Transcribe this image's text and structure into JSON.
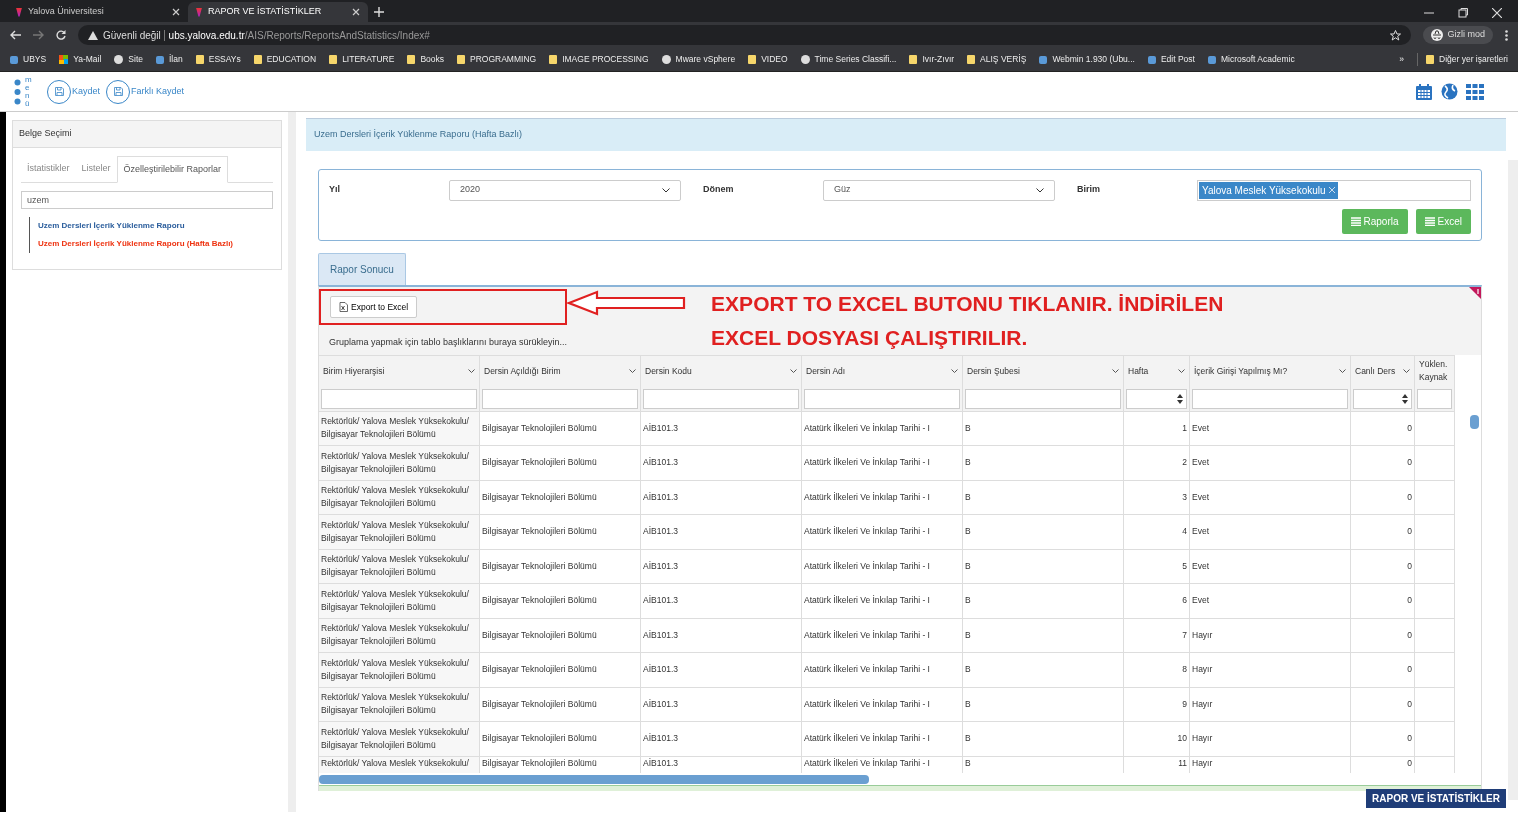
{
  "browser": {
    "tabs": [
      {
        "title": "Yalova Üniversitesi",
        "selected": false
      },
      {
        "title": "RAPOR VE İSTATİSTİKLER",
        "selected": true
      }
    ],
    "address": {
      "security": "Güvenli değil",
      "host": "ubs.yalova.edu.tr",
      "path": "/AIS/Reports/ReportsAndStatistics/Index#"
    },
    "profile": "Gizli mod",
    "bookmarks": [
      {
        "label": "UBYS",
        "kind": "app"
      },
      {
        "label": "Ya-Mail",
        "kind": "windows"
      },
      {
        "label": "Site",
        "kind": "globe"
      },
      {
        "label": "İlan",
        "kind": "app"
      },
      {
        "label": "ESSAYs",
        "kind": "folder"
      },
      {
        "label": "EDUCATION",
        "kind": "folder"
      },
      {
        "label": "LITERATURE",
        "kind": "folder"
      },
      {
        "label": "Books",
        "kind": "folder"
      },
      {
        "label": "PROGRAMMING",
        "kind": "folder"
      },
      {
        "label": "IMAGE PROCESSING",
        "kind": "folder"
      },
      {
        "label": "Mware vSphere",
        "kind": "globe"
      },
      {
        "label": "VIDEO",
        "kind": "folder"
      },
      {
        "label": "Time Series Classifi...",
        "kind": "globe"
      },
      {
        "label": "Ivır-Zıvır",
        "kind": "folder"
      },
      {
        "label": "ALIŞ VERİŞ",
        "kind": "folder"
      },
      {
        "label": "Webmin 1.930 (Ubu...",
        "kind": "app"
      },
      {
        "label": "Edit Post",
        "kind": "app"
      },
      {
        "label": "Microsoft Academic",
        "kind": "app"
      }
    ],
    "overflow": "»",
    "other_bookmarks": "Diğer yer işaretleri"
  },
  "toolbar": {
    "menu_label": "menü",
    "buttons": [
      "Kaydet",
      "Farklı Kaydet"
    ]
  },
  "sidebar": {
    "title": "Belge Seçimi",
    "tabs": [
      {
        "label": "İstatistikler",
        "selected": false
      },
      {
        "label": "Listeler",
        "selected": false
      },
      {
        "label": "Özelleştirilebilir Raporlar",
        "selected": true
      }
    ],
    "search": "uzem",
    "items": [
      {
        "label": "Uzem Dersleri İçerik Yüklenme Raporu",
        "selected": false
      },
      {
        "label": "Uzem Dersleri İçerik Yüklenme Raporu (Hafta Bazlı)",
        "selected": true
      }
    ]
  },
  "report": {
    "title": "Uzem Dersleri İçerik Yüklenme Raporu (Hafta Bazlı)",
    "filters": [
      {
        "label": "Yıl",
        "kind": "select",
        "value": "2020"
      },
      {
        "label": "Dönem",
        "kind": "select",
        "value": "Güz"
      },
      {
        "label": "Birim",
        "kind": "tags",
        "value": "Yalova Meslek Yüksekokulu"
      }
    ],
    "buttons": [
      "Raporla",
      "Excel"
    ],
    "result_tab": "Rapor Sonucu",
    "export_button": "Export to Excel",
    "group_hint": "Gruplama yapmak için tablo başlıklarını buraya sürükleyin...",
    "annotation": [
      "EXPORT TO EXCEL BUTONU TIKLANIR. İNDİRİLEN",
      "EXCEL DOSYASI ÇALIŞTIRILIR."
    ],
    "columns": [
      {
        "label": "Birim Hiyerarşisi",
        "kind": "text"
      },
      {
        "label": "Dersin Açıldığı Birim",
        "kind": "text"
      },
      {
        "label": "Dersin Kodu",
        "kind": "text"
      },
      {
        "label": "Dersin Adı",
        "kind": "text"
      },
      {
        "label": "Dersin Şubesi",
        "kind": "text"
      },
      {
        "label": "Hafta",
        "kind": "number"
      },
      {
        "label": "İçerik Girişi Yapılmış Mı?",
        "kind": "text"
      },
      {
        "label": "Canlı Ders",
        "kind": "number"
      },
      {
        "label": "Yüklen. Kaynak",
        "kind": "cut"
      }
    ],
    "rows": [
      [
        "Rektörlük/ Yalova Meslek Yüksekokulu/ Bilgisayar Teknolojileri Bölümü",
        "Bilgisayar Teknolojileri Bölümü",
        "AİB101.3",
        "Atatürk İlkeleri Ve İnkılap Tarihi - I",
        "B",
        "1",
        "Evet",
        "0"
      ],
      [
        "Rektörlük/ Yalova Meslek Yüksekokulu/ Bilgisayar Teknolojileri Bölümü",
        "Bilgisayar Teknolojileri Bölümü",
        "AİB101.3",
        "Atatürk İlkeleri Ve İnkılap Tarihi - I",
        "B",
        "2",
        "Evet",
        "0"
      ],
      [
        "Rektörlük/ Yalova Meslek Yüksekokulu/ Bilgisayar Teknolojileri Bölümü",
        "Bilgisayar Teknolojileri Bölümü",
        "AİB101.3",
        "Atatürk İlkeleri Ve İnkılap Tarihi - I",
        "B",
        "3",
        "Evet",
        "0"
      ],
      [
        "Rektörlük/ Yalova Meslek Yüksekokulu/ Bilgisayar Teknolojileri Bölümü",
        "Bilgisayar Teknolojileri Bölümü",
        "AİB101.3",
        "Atatürk İlkeleri Ve İnkılap Tarihi - I",
        "B",
        "4",
        "Evet",
        "0"
      ],
      [
        "Rektörlük/ Yalova Meslek Yüksekokulu/ Bilgisayar Teknolojileri Bölümü",
        "Bilgisayar Teknolojileri Bölümü",
        "AİB101.3",
        "Atatürk İlkeleri Ve İnkılap Tarihi - I",
        "B",
        "5",
        "Evet",
        "0"
      ],
      [
        "Rektörlük/ Yalova Meslek Yüksekokulu/ Bilgisayar Teknolojileri Bölümü",
        "Bilgisayar Teknolojileri Bölümü",
        "AİB101.3",
        "Atatürk İlkeleri Ve İnkılap Tarihi - I",
        "B",
        "6",
        "Evet",
        "0"
      ],
      [
        "Rektörlük/ Yalova Meslek Yüksekokulu/ Bilgisayar Teknolojileri Bölümü",
        "Bilgisayar Teknolojileri Bölümü",
        "AİB101.3",
        "Atatürk İlkeleri Ve İnkılap Tarihi - I",
        "B",
        "7",
        "Hayır",
        "0"
      ],
      [
        "Rektörlük/ Yalova Meslek Yüksekokulu/ Bilgisayar Teknolojileri Bölümü",
        "Bilgisayar Teknolojileri Bölümü",
        "AİB101.3",
        "Atatürk İlkeleri Ve İnkılap Tarihi - I",
        "B",
        "8",
        "Hayır",
        "0"
      ],
      [
        "Rektörlük/ Yalova Meslek Yüksekokulu/ Bilgisayar Teknolojileri Bölümü",
        "Bilgisayar Teknolojileri Bölümü",
        "AİB101.3",
        "Atatürk İlkeleri Ve İnkılap Tarihi - I",
        "B",
        "9",
        "Hayır",
        "0"
      ],
      [
        "Rektörlük/ Yalova Meslek Yüksekokulu/ Bilgisayar Teknolojileri Bölümü",
        "Bilgisayar Teknolojileri Bölümü",
        "AİB101.3",
        "Atatürk İlkeleri Ve İnkılap Tarihi - I",
        "B",
        "10",
        "Hayır",
        "0"
      ],
      [
        "Rektörlük/ Yalova Meslek Yüksekokulu/",
        "Bilgisayar Teknolojileri Bölümü",
        "AİB101.3",
        "Atatürk İlkeleri Ve İnkılap Tarihi - I",
        "B",
        "11",
        "Hayır",
        "0"
      ]
    ],
    "footer_badge": "RAPOR VE İSTATİSTİKLER"
  }
}
